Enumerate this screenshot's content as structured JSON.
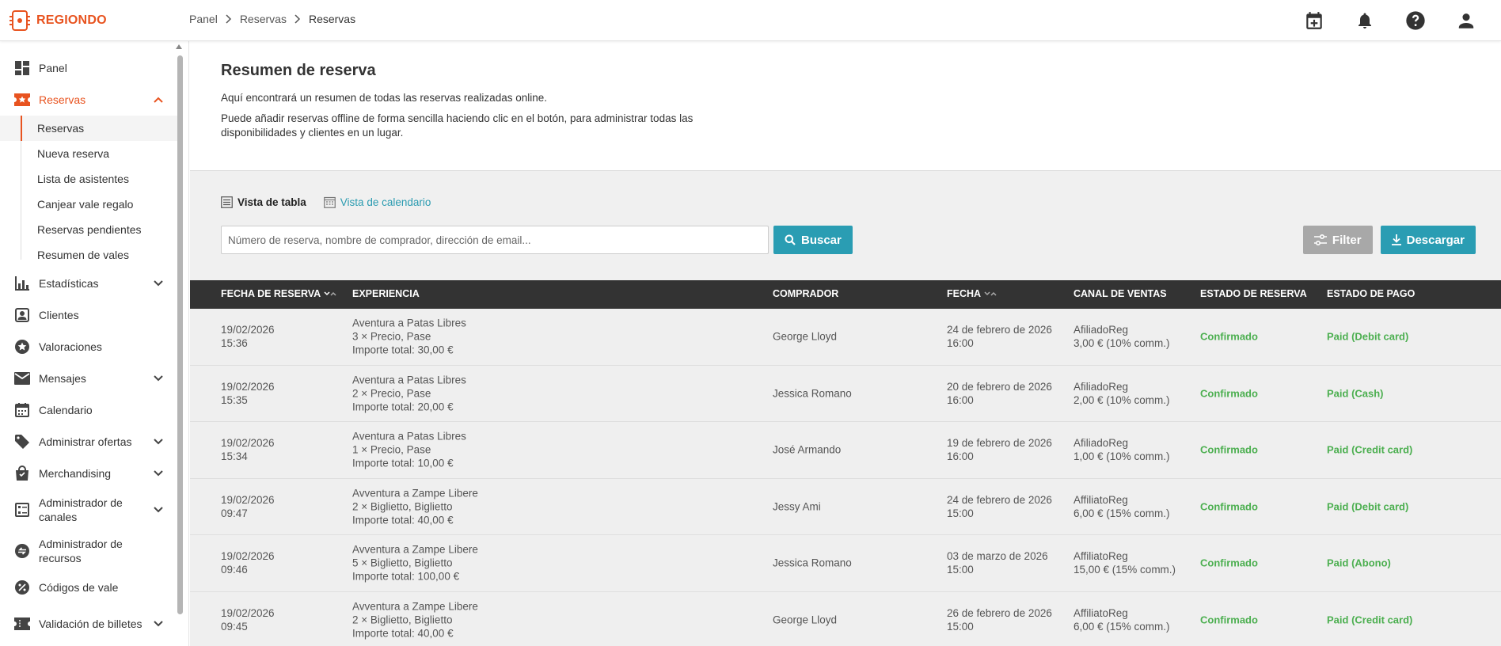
{
  "brand": {
    "name": "REGIONDO",
    "accent": "#e8531f",
    "teal": "#2a9db3",
    "success": "#4caf50"
  },
  "breadcrumb": [
    "Panel",
    "Reservas",
    "Reservas"
  ],
  "top_icons": [
    "calendar-add-icon",
    "bell-icon",
    "help-icon",
    "user-icon"
  ],
  "sidebar": {
    "items": [
      {
        "label": "Panel",
        "icon": "dashboard-icon"
      },
      {
        "label": "Reservas",
        "icon": "ticket-star-icon",
        "expanded": true,
        "active": true,
        "sub": [
          "Reservas",
          "Nueva reserva",
          "Lista de asistentes",
          "Canjear vale regalo",
          "Reservas pendientes",
          "Resumen de vales"
        ]
      },
      {
        "label": "Estadísticas",
        "icon": "bar-chart-icon",
        "chevron": true
      },
      {
        "label": "Clientes",
        "icon": "person-card-icon"
      },
      {
        "label": "Valoraciones",
        "icon": "star-circle-icon"
      },
      {
        "label": "Mensajes",
        "icon": "mail-icon",
        "chevron": true
      },
      {
        "label": "Calendario",
        "icon": "calendar-icon"
      },
      {
        "label": "Administrar ofertas",
        "icon": "tag-icon",
        "chevron": true
      },
      {
        "label": "Merchandising",
        "icon": "shopping-bag-icon",
        "chevron": true
      },
      {
        "label": "Administrador de canales",
        "icon": "channels-icon",
        "chevron": true
      },
      {
        "label": "Administrador de recursos",
        "icon": "resources-icon"
      },
      {
        "label": "Códigos de vale",
        "icon": "percent-icon"
      },
      {
        "label": "Validación de billetes",
        "icon": "ticket-icon",
        "chevron": true
      }
    ]
  },
  "intro": {
    "title": "Resumen de reserva",
    "line1": "Aquí encontrará un resumen de todas las reservas realizadas online.",
    "line2": "Puede añadir reservas offline de forma sencilla haciendo clic en el botón, para administrar todas las disponibilidades y clientes en un lugar."
  },
  "views": {
    "table": "Vista de tabla",
    "calendar": "Vista de calendario"
  },
  "search": {
    "placeholder": "Número de reserva, nombre de comprador, dirección de email...",
    "value": "",
    "button": "Buscar"
  },
  "actions": {
    "filter": "Filter",
    "download": "Descargar"
  },
  "table": {
    "columns": [
      "FECHA DE RESERVA",
      "EXPERIENCIA",
      "COMPRADOR",
      "FECHA",
      "CANAL DE VENTAS",
      "ESTADO DE RESERVA",
      "ESTADO DE PAGO"
    ],
    "rows": [
      {
        "booked_date": "19/02/2026",
        "booked_time": "15:36",
        "exp_title": "Aventura a Patas Libres",
        "exp_detail": "3 × Precio, Pase",
        "exp_total": "Importe total: 30,00 €",
        "buyer": "George Lloyd",
        "date": "24 de febrero de 2026",
        "time": "16:00",
        "channel": "AfiliadoReg",
        "commission": "3,00 € (10% comm.)",
        "status": "Confirmado",
        "payment": "Paid (Debit card)"
      },
      {
        "booked_date": "19/02/2026",
        "booked_time": "15:35",
        "exp_title": "Aventura a Patas Libres",
        "exp_detail": "2 × Precio, Pase",
        "exp_total": "Importe total: 20,00 €",
        "buyer": "Jessica Romano",
        "date": "20 de febrero de 2026",
        "time": "16:00",
        "channel": "AfiliadoReg",
        "commission": "2,00 € (10% comm.)",
        "status": "Confirmado",
        "payment": "Paid (Cash)"
      },
      {
        "booked_date": "19/02/2026",
        "booked_time": "15:34",
        "exp_title": "Aventura a Patas Libres",
        "exp_detail": "1 × Precio, Pase",
        "exp_total": "Importe total: 10,00 €",
        "buyer": "José Armando",
        "date": "19 de febrero de 2026",
        "time": "16:00",
        "channel": "AfiliadoReg",
        "commission": "1,00 € (10% comm.)",
        "status": "Confirmado",
        "payment": "Paid (Credit card)"
      },
      {
        "booked_date": "19/02/2026",
        "booked_time": "09:47",
        "exp_title": "Avventura a Zampe Libere",
        "exp_detail": "2 × Biglietto, Biglietto",
        "exp_total": "Importe total: 40,00 €",
        "buyer": "Jessy Ami",
        "date": "24 de febrero de 2026",
        "time": "15:00",
        "channel": "AffiliatoReg",
        "commission": "6,00 € (15% comm.)",
        "status": "Confirmado",
        "payment": "Paid (Debit card)"
      },
      {
        "booked_date": "19/02/2026",
        "booked_time": "09:46",
        "exp_title": "Avventura a Zampe Libere",
        "exp_detail": "5 × Biglietto, Biglietto",
        "exp_total": "Importe total: 100,00 €",
        "buyer": "Jessica Romano",
        "date": "03 de marzo de 2026",
        "time": "15:00",
        "channel": "AffiliatoReg",
        "commission": "15,00 € (15% comm.)",
        "status": "Confirmado",
        "payment": "Paid (Abono)"
      },
      {
        "booked_date": "19/02/2026",
        "booked_time": "09:45",
        "exp_title": "Avventura a Zampe Libere",
        "exp_detail": "2 × Biglietto, Biglietto",
        "exp_total": "Importe total: 40,00 €",
        "buyer": "George Lloyd",
        "date": "26 de febrero de 2026",
        "time": "15:00",
        "channel": "AffiliatoReg",
        "commission": "6,00 € (15% comm.)",
        "status": "Confirmado",
        "payment": "Paid (Credit card)"
      }
    ]
  }
}
